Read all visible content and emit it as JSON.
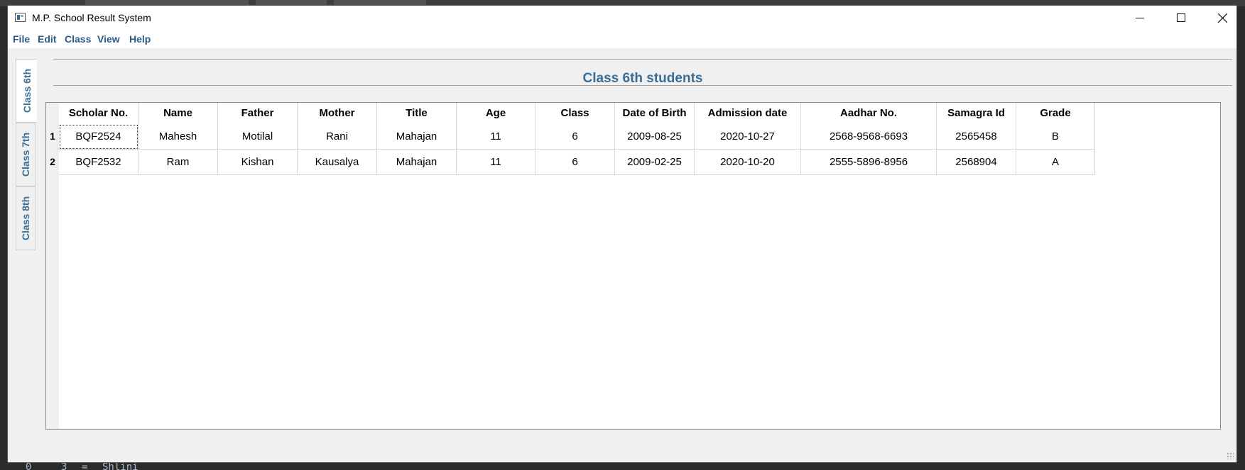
{
  "window": {
    "title": "M.P. School Result System"
  },
  "menu": [
    "File",
    "Edit",
    "Class",
    "View",
    "Help"
  ],
  "side_tabs": [
    {
      "label": "Class 6th",
      "active": true
    },
    {
      "label": "Class 7th",
      "active": false
    },
    {
      "label": "Class 8th",
      "active": false
    }
  ],
  "page": {
    "heading": "Class 6th students"
  },
  "table": {
    "columns": [
      "Scholar No.",
      "Name",
      "Father",
      "Mother",
      "Title",
      "Age",
      "Class",
      "Date of Birth",
      "Admission date",
      "Aadhar No.",
      "Samagra Id",
      "Grade"
    ],
    "rows": [
      {
        "num": "1",
        "cells": [
          "BQF2524",
          "Mahesh",
          "Motilal",
          "Rani",
          "Mahajan",
          "11",
          "6",
          "2009-08-25",
          "2020-10-27",
          "2568-9568-6693",
          "2565458",
          "B"
        ]
      },
      {
        "num": "2",
        "cells": [
          "BQF2532",
          "Ram",
          "Kishan",
          "Kausalya",
          "Mahajan",
          "11",
          "6",
          "2009-02-25",
          "2020-10-20",
          "2555-5896-8956",
          "2568904",
          "A"
        ]
      }
    ]
  },
  "background": {
    "bottom_text": [
      "0",
      "3",
      "=",
      "Shlini"
    ]
  },
  "colors": {
    "accent": "#3a6d95",
    "menu_text": "#2a5a85",
    "window_bg": "#f0f0f0"
  }
}
